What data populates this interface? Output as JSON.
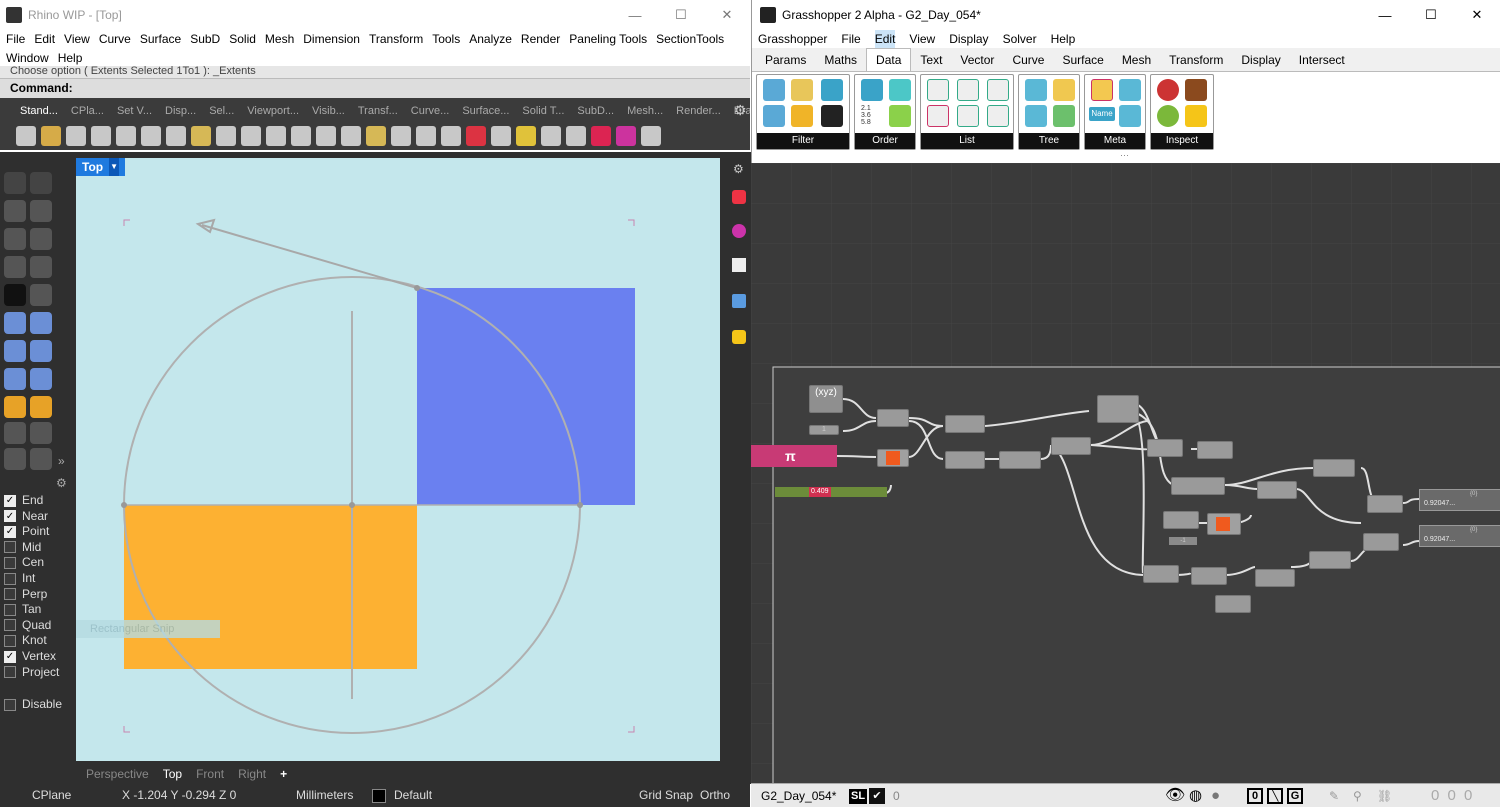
{
  "rhino": {
    "title": "Rhino WIP - [Top]",
    "window_buttons": [
      "—",
      "☐",
      "✕"
    ],
    "menu": [
      "File",
      "Edit",
      "View",
      "Curve",
      "Surface",
      "SubD",
      "Solid",
      "Mesh",
      "Dimension",
      "Transform",
      "Tools",
      "Analyze",
      "Render",
      "Paneling Tools",
      "SectionTools",
      "Window",
      "Help"
    ],
    "command_history": "Choose option ( Extents  Selected  1To1 ): _Extents",
    "command_prompt": "Command:",
    "toolbar_tabs": [
      "Stand...",
      "CPla...",
      "Set V...",
      "Disp...",
      "Sel...",
      "Viewport...",
      "Visib...",
      "Transf...",
      "Curve...",
      "Surface...",
      "Solid T...",
      "SubD...",
      "Mesh...",
      "Render...",
      "Draft..."
    ],
    "viewport_label": "Top",
    "viewport_tabs": [
      "Perspective",
      "Top",
      "Front",
      "Right"
    ],
    "add_tab": "+",
    "ghost_tooltip": "Rectangular Snip",
    "osnaps": [
      {
        "label": "End",
        "checked": true
      },
      {
        "label": "Near",
        "checked": true
      },
      {
        "label": "Point",
        "checked": true
      },
      {
        "label": "Mid",
        "checked": false
      },
      {
        "label": "Cen",
        "checked": false
      },
      {
        "label": "Int",
        "checked": false
      },
      {
        "label": "Perp",
        "checked": false
      },
      {
        "label": "Tan",
        "checked": false
      },
      {
        "label": "Quad",
        "checked": false
      },
      {
        "label": "Knot",
        "checked": false
      },
      {
        "label": "Vertex",
        "checked": true
      },
      {
        "label": "Project",
        "checked": false
      }
    ],
    "disable_label": "Disable",
    "status": {
      "cplane": "CPlane",
      "coords": "X -1.204  Y -0.294  Z 0",
      "units": "Millimeters",
      "layer": "Default",
      "grid_snap": "Grid Snap",
      "ortho": "Ortho"
    },
    "colors": {
      "viewport_bg": "#c4e7ec",
      "blue_rect": "#6a80f0",
      "orange_rect": "#fdb132",
      "active_tab": "#1f7adf"
    }
  },
  "gh": {
    "title": "Grasshopper 2 Alpha - G2_Day_054*",
    "menu": [
      "Grasshopper",
      "File",
      "Edit",
      "View",
      "Display",
      "Solver",
      "Help"
    ],
    "tabs": [
      "Params",
      "Maths",
      "Data",
      "Text",
      "Vector",
      "Curve",
      "Surface",
      "Mesh",
      "Transform",
      "Display",
      "Intersect"
    ],
    "active_tab": "Data",
    "groups": [
      "Filter",
      "Order",
      "List",
      "Tree",
      "Meta",
      "Inspect"
    ],
    "order_numbers": "2.1\n3.6\n5.8",
    "meta_name": "Name",
    "canvas_nodes": {
      "xyz": "(xyz)",
      "pi": "π",
      "slider_value": "0.409",
      "one": "1",
      "minus_one": "-1",
      "panel_value_1": "0.92047...",
      "panel_value_2": "0.92047...",
      "panel_header": "{0}"
    },
    "status": {
      "file": "G2_Day_054*",
      "sl": "SL",
      "zero_1": "0",
      "counts": "0   0   0"
    }
  }
}
